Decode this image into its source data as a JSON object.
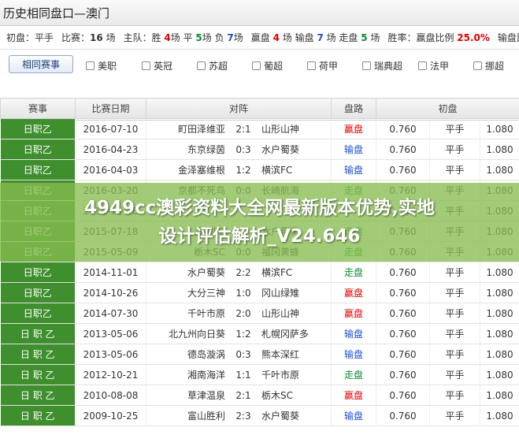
{
  "title": "历史相同盘口—澳门",
  "stats": [
    {
      "label": "初盘：",
      "parts": [
        {
          "t": "平手",
          "c": "gray"
        }
      ]
    },
    {
      "label": "比赛：",
      "parts": [
        {
          "t": "16",
          "c": "gray",
          "b": true
        },
        {
          "t": " 场",
          "c": "gray"
        }
      ]
    },
    {
      "label": "主队：",
      "parts": [
        {
          "t": "胜 ",
          "c": "gray"
        },
        {
          "t": "4",
          "c": "red",
          "b": true
        },
        {
          "t": "场 平 ",
          "c": "gray"
        },
        {
          "t": "5",
          "c": "green",
          "b": true
        },
        {
          "t": "场 负 ",
          "c": "gray"
        },
        {
          "t": "7",
          "c": "blue",
          "b": true
        },
        {
          "t": "场",
          "c": "gray"
        }
      ]
    },
    {
      "label": "赢盘 ",
      "parts": [
        {
          "t": "4",
          "c": "red",
          "b": true
        },
        {
          "t": " 场 输盘 ",
          "c": "gray"
        },
        {
          "t": "7",
          "c": "blue",
          "b": true
        },
        {
          "t": " 场 走盘 ",
          "c": "gray"
        },
        {
          "t": "5",
          "c": "green",
          "b": true
        },
        {
          "t": " 场",
          "c": "gray"
        }
      ]
    },
    {
      "label": "胜率：",
      "parts": [
        {
          "t": "赢盘比例 ",
          "c": "gray"
        },
        {
          "t": "25.0%",
          "c": "red",
          "b": true
        }
      ]
    },
    {
      "label": "输盘比",
      "parts": []
    }
  ],
  "buttons": {
    "history": "相同赛事",
    "select_all": "全选",
    "invert": "反选"
  },
  "leagues": [
    "美职",
    "英冠",
    "苏超",
    "葡超",
    "荷甲",
    "瑞典超",
    "法甲",
    "挪超"
  ],
  "columns": [
    "赛事",
    "比赛日期",
    "对阵",
    "盘路",
    "初盘"
  ],
  "rows": [
    {
      "league": "日职乙",
      "date": "2016-07-10",
      "home": "町田泽维亚",
      "score": "2:1",
      "away": "山形山神",
      "result": "赢盘",
      "rc": "red",
      "o1": "0.760",
      "line": "平手",
      "o2": "1.080"
    },
    {
      "league": "日职乙",
      "date": "2016-04-23",
      "home": "东京绿茵",
      "score": "0:3",
      "away": "水户蜀葵",
      "result": "输盘",
      "rc": "blue",
      "o1": "0.760",
      "line": "平手",
      "o2": "1.080"
    },
    {
      "league": "日职乙",
      "date": "2016-04-03",
      "home": "金泽塞维根",
      "score": "1:2",
      "away": "横滨FC",
      "result": "输盘",
      "rc": "blue",
      "o1": "0.760",
      "line": "平手",
      "o2": "1.080"
    },
    {
      "league": "日职乙",
      "date": "2016-03-20",
      "home": "京都不死鸟",
      "score": "0:0",
      "away": "长崎航海",
      "result": "走盘",
      "rc": "green",
      "o1": "0.760",
      "line": "平手",
      "o2": "1.080"
    },
    {
      "league": "日职乙",
      "date": "2015-11-08",
      "home": "",
      "score": "",
      "away": "",
      "result": "",
      "rc": "gray",
      "o1": "0.760",
      "line": "平手",
      "o2": "1.080"
    },
    {
      "league": "日职乙",
      "date": "2015-07-18",
      "home": "爱媛FC",
      "score": "",
      "away": "水户蜀葵",
      "result": "走盘",
      "rc": "green",
      "o1": "0.760",
      "line": "平手",
      "o2": "1.080"
    },
    {
      "league": "日职乙",
      "date": "2015-05-09",
      "home": "栃木SC",
      "score": "0:0",
      "away": "福冈黄蜂",
      "result": "走盘",
      "rc": "green",
      "o1": "0.760",
      "line": "平手",
      "o2": "1.080"
    },
    {
      "league": "日职乙",
      "date": "2014-11-01",
      "home": "水户蜀葵",
      "score": "2:2",
      "away": "横滨FC",
      "result": "走盘",
      "rc": "green",
      "o1": "0.760",
      "line": "平手",
      "o2": "1.080"
    },
    {
      "league": "日职乙",
      "date": "2014-10-26",
      "home": "大分三神",
      "score": "1:0",
      "away": "冈山绿雉",
      "result": "赢盘",
      "rc": "red",
      "o1": "0.760",
      "line": "平手",
      "o2": "1.080"
    },
    {
      "league": "日职乙",
      "date": "2014-07-30",
      "home": "千叶市原",
      "score": "2:0",
      "away": "山形山神",
      "result": "赢盘",
      "rc": "red",
      "o1": "0.760",
      "line": "平手",
      "o2": "1.080"
    },
    {
      "league": "日 职 乙",
      "date": "2013-05-06",
      "home": "北九州向日葵",
      "score": "1:2",
      "away": "札幌冈萨多",
      "result": "输盘",
      "rc": "blue",
      "o1": "0.760",
      "line": "平手",
      "o2": "1.080"
    },
    {
      "league": "日 职 乙",
      "date": "2013-05-06",
      "home": "德岛漩涡",
      "score": "0:3",
      "away": "熊本深红",
      "result": "输盘",
      "rc": "blue",
      "o1": "0.760",
      "line": "平手",
      "o2": "1.080"
    },
    {
      "league": "日 职 乙",
      "date": "2012-10-21",
      "home": "湘南海洋",
      "score": "1:1",
      "away": "千叶市原",
      "result": "走盘",
      "rc": "green",
      "o1": "0.760",
      "line": "平手",
      "o2": "1.080"
    },
    {
      "league": "日 职 乙",
      "date": "2010-08-08",
      "home": "草津温泉",
      "score": "2:1",
      "away": "栃木SC",
      "result": "赢盘",
      "rc": "red",
      "o1": "0.760",
      "line": "平手",
      "o2": "1.080"
    },
    {
      "league": "日 职 乙",
      "date": "2009-10-25",
      "home": "富山胜利",
      "score": "2:3",
      "away": "水户蜀葵",
      "result": "输盘",
      "rc": "blue",
      "o1": "0.760",
      "line": "平手",
      "o2": "1.080"
    }
  ],
  "watermark": [
    "4949cc澳彩资料大全网最新版本优势,实地",
    "设计评估解析_V24.646"
  ]
}
